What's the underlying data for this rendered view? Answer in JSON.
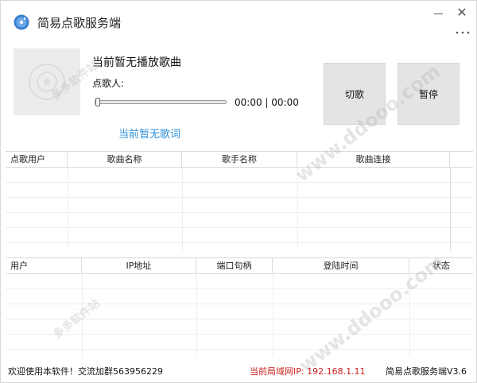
{
  "window": {
    "title": "简易点歌服务端",
    "more_glyph": "⋮",
    "close_glyph": "✕"
  },
  "player": {
    "now_playing": "当前暂无播放歌曲",
    "requester_label": "点歌人:",
    "time_display": "00:00 | 00:00",
    "progress": 0,
    "lyrics": "当前暂无歌词",
    "cut_label": "切歌",
    "pause_label": "暂停"
  },
  "songs_table": {
    "columns": [
      "点歌用户",
      "歌曲名称",
      "歌手名称",
      "歌曲连接"
    ],
    "rows": []
  },
  "users_table": {
    "columns": [
      "用户",
      "IP地址",
      "端口句柄",
      "登陆时间",
      "状态"
    ],
    "rows": []
  },
  "status": {
    "welcome": "欢迎使用本软件！交流加群563956229",
    "ip": "当前局域网IP: 192.168.1.11",
    "version": "简易点歌服务端V3.6"
  },
  "watermark": {
    "cn": "多多软件站",
    "en": "www.ddooo.com"
  },
  "colors": {
    "accent": "#2f8fd8",
    "ip_text": "#cc1f1f",
    "button_bg": "#e4e4e4"
  },
  "icons": {
    "app": "music-disc-icon",
    "cover": "disc-placeholder-icon"
  }
}
